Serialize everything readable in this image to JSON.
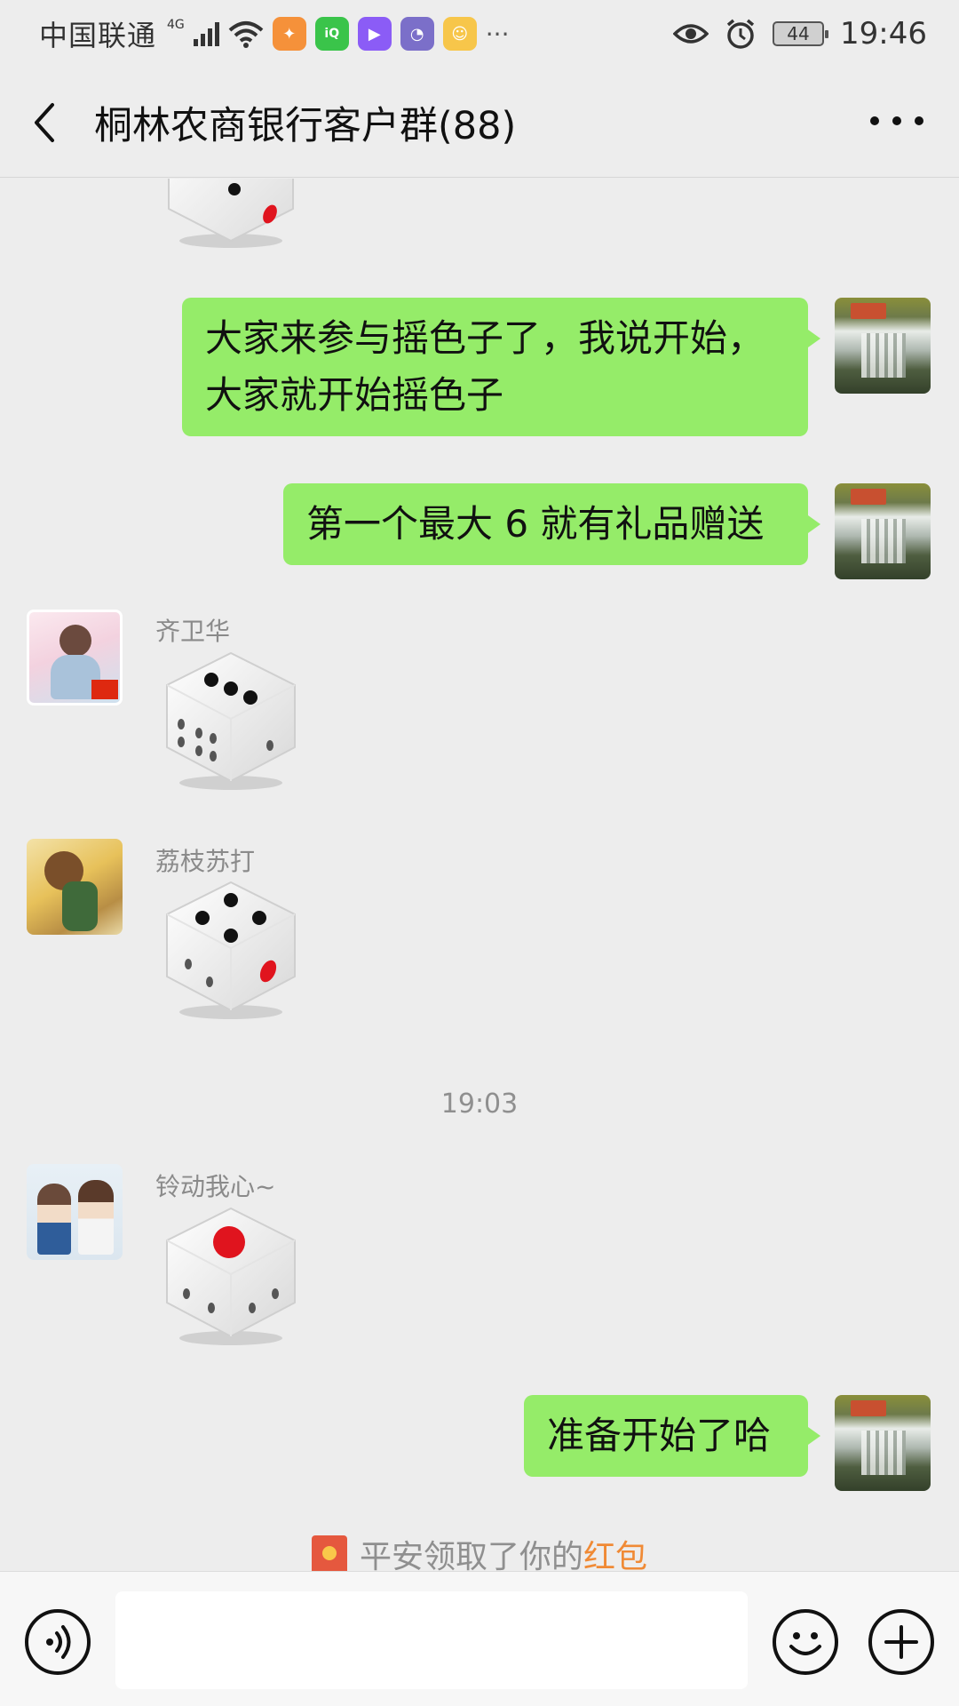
{
  "status_bar": {
    "carrier": "中国联通",
    "network": "4G",
    "battery": "44",
    "time": "19:46"
  },
  "header": {
    "title": "桐林农商银行客户群(88)"
  },
  "messages": {
    "self_msg_1": "大家来参与摇色子了，我说开始，大家就开始摇色子",
    "self_msg_2": "第一个最大 6 就有礼品赠送",
    "qi_name": "齐卫华",
    "qi_dice_value": 3,
    "li_name": "荔枝苏打",
    "li_dice_value": 4,
    "time_separator": "19:03",
    "ling_name": "铃动我心~",
    "ling_dice_value": 1,
    "self_msg_3": "准备开始了哈",
    "system_prefix": "平安领取了你的",
    "system_highlight": "红包"
  },
  "colors": {
    "background": "#ededed",
    "self_bubble": "#95ec69",
    "highlight": "#f08a35",
    "dice_pip": "#111111",
    "dice_red": "#e0141e"
  }
}
